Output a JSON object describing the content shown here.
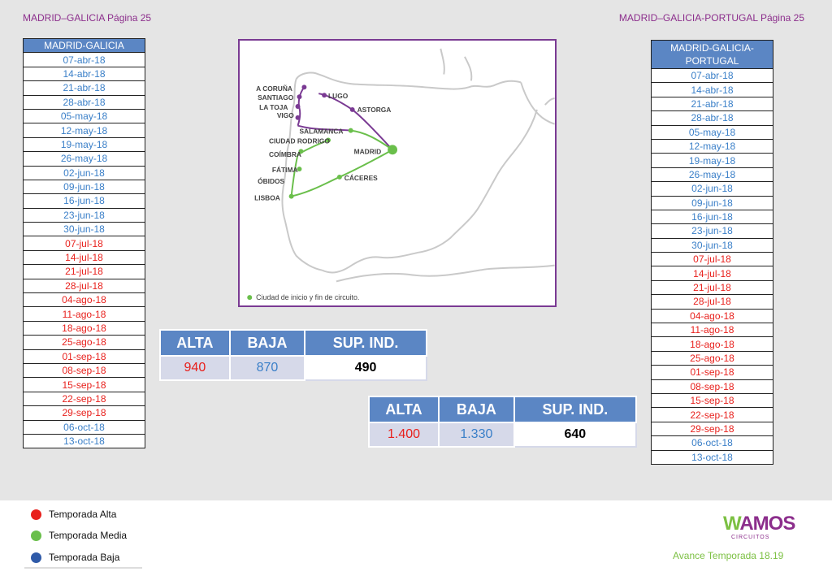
{
  "header": {
    "left": "MADRID–GALICIA Página 25",
    "right": "MADRID–GALICIA-PORTUGAL Página 25"
  },
  "table_madrid_galicia": {
    "title": "MADRID-GALICIA",
    "rows": [
      {
        "date": "07-abr-18",
        "season": "blue"
      },
      {
        "date": "14-abr-18",
        "season": "blue"
      },
      {
        "date": "21-abr-18",
        "season": "blue"
      },
      {
        "date": "28-abr-18",
        "season": "blue"
      },
      {
        "date": "05-may-18",
        "season": "blue"
      },
      {
        "date": "12-may-18",
        "season": "blue"
      },
      {
        "date": "19-may-18",
        "season": "blue"
      },
      {
        "date": "26-may-18",
        "season": "blue"
      },
      {
        "date": "02-jun-18",
        "season": "blue"
      },
      {
        "date": "09-jun-18",
        "season": "blue"
      },
      {
        "date": "16-jun-18",
        "season": "blue"
      },
      {
        "date": "23-jun-18",
        "season": "blue"
      },
      {
        "date": "30-jun-18",
        "season": "blue"
      },
      {
        "date": "07-jul-18",
        "season": "red"
      },
      {
        "date": "14-jul-18",
        "season": "red"
      },
      {
        "date": "21-jul-18",
        "season": "red"
      },
      {
        "date": "28-jul-18",
        "season": "red"
      },
      {
        "date": "04-ago-18",
        "season": "red"
      },
      {
        "date": "11-ago-18",
        "season": "red"
      },
      {
        "date": "18-ago-18",
        "season": "red"
      },
      {
        "date": "25-ago-18",
        "season": "red"
      },
      {
        "date": "01-sep-18",
        "season": "red"
      },
      {
        "date": "08-sep-18",
        "season": "red"
      },
      {
        "date": "15-sep-18",
        "season": "red"
      },
      {
        "date": "22-sep-18",
        "season": "red"
      },
      {
        "date": "29-sep-18",
        "season": "red"
      },
      {
        "date": "06-oct-18",
        "season": "blue"
      },
      {
        "date": "13-oct-18",
        "season": "blue"
      }
    ]
  },
  "table_madrid_galicia_portugal": {
    "title": "MADRID-GALICIA-PORTUGAL",
    "rows": [
      {
        "date": "07-abr-18",
        "season": "blue"
      },
      {
        "date": "14-abr-18",
        "season": "blue"
      },
      {
        "date": "21-abr-18",
        "season": "blue"
      },
      {
        "date": "28-abr-18",
        "season": "blue"
      },
      {
        "date": "05-may-18",
        "season": "blue"
      },
      {
        "date": "12-may-18",
        "season": "blue"
      },
      {
        "date": "19-may-18",
        "season": "blue"
      },
      {
        "date": "26-may-18",
        "season": "blue"
      },
      {
        "date": "02-jun-18",
        "season": "blue"
      },
      {
        "date": "09-jun-18",
        "season": "blue"
      },
      {
        "date": "16-jun-18",
        "season": "blue"
      },
      {
        "date": "23-jun-18",
        "season": "blue"
      },
      {
        "date": "30-jun-18",
        "season": "blue"
      },
      {
        "date": "07-jul-18",
        "season": "red"
      },
      {
        "date": "14-jul-18",
        "season": "red"
      },
      {
        "date": "21-jul-18",
        "season": "red"
      },
      {
        "date": "28-jul-18",
        "season": "red"
      },
      {
        "date": "04-ago-18",
        "season": "red"
      },
      {
        "date": "11-ago-18",
        "season": "red"
      },
      {
        "date": "18-ago-18",
        "season": "red"
      },
      {
        "date": "25-ago-18",
        "season": "red"
      },
      {
        "date": "01-sep-18",
        "season": "red"
      },
      {
        "date": "08-sep-18",
        "season": "red"
      },
      {
        "date": "15-sep-18",
        "season": "red"
      },
      {
        "date": "22-sep-18",
        "season": "red"
      },
      {
        "date": "29-sep-18",
        "season": "red"
      },
      {
        "date": "06-oct-18",
        "season": "blue"
      },
      {
        "date": "13-oct-18",
        "season": "blue"
      }
    ]
  },
  "map": {
    "cities": {
      "coruna": "A CORUÑA",
      "santiago": "SANTIAGO",
      "latoja": "LA TOJA",
      "vigo": "VIGO",
      "lugo": "LUGO",
      "astorga": "ASTORGA",
      "salamanca": "SALAMANCA",
      "ciudadrodrigo": "CIUDAD RODRIGO",
      "coimbra": "COÍMBRA",
      "madrid": "MADRID",
      "fatima": "FÁTIMA",
      "obidos": "ÓBIDOS",
      "caceres": "CÁCERES",
      "lisboa": "LISBOA"
    },
    "caption": "Ciudad de inicio y fin de circuito."
  },
  "price_table_1": {
    "headers": [
      "ALTA",
      "BAJA",
      "SUP. IND."
    ],
    "alta": "940",
    "baja": "870",
    "sup": "490"
  },
  "price_table_2": {
    "headers": [
      "ALTA",
      "BAJA",
      "SUP. IND."
    ],
    "alta": "1.400",
    "baja": "1.330",
    "sup": "640"
  },
  "legend": {
    "items": [
      {
        "label": "Temporada Alta",
        "color": "#e8201c"
      },
      {
        "label": "Temporada Media",
        "color": "#6abf4b"
      },
      {
        "label": "Temporada Baja",
        "color": "#2f5aa8"
      }
    ]
  },
  "brand": {
    "logo_first": "W",
    "logo_rest": "AMOS",
    "logo_sub": "CIRCUITOS",
    "tagline": "Avance Temporada 18.19"
  },
  "colors": {
    "purple": "#8c2e8c",
    "header_blue": "#5b86c4",
    "high_season": "#e8201c",
    "low_season": "#3a7fc8",
    "route_green": "#6abf4b",
    "route_purple": "#7a3a93"
  }
}
